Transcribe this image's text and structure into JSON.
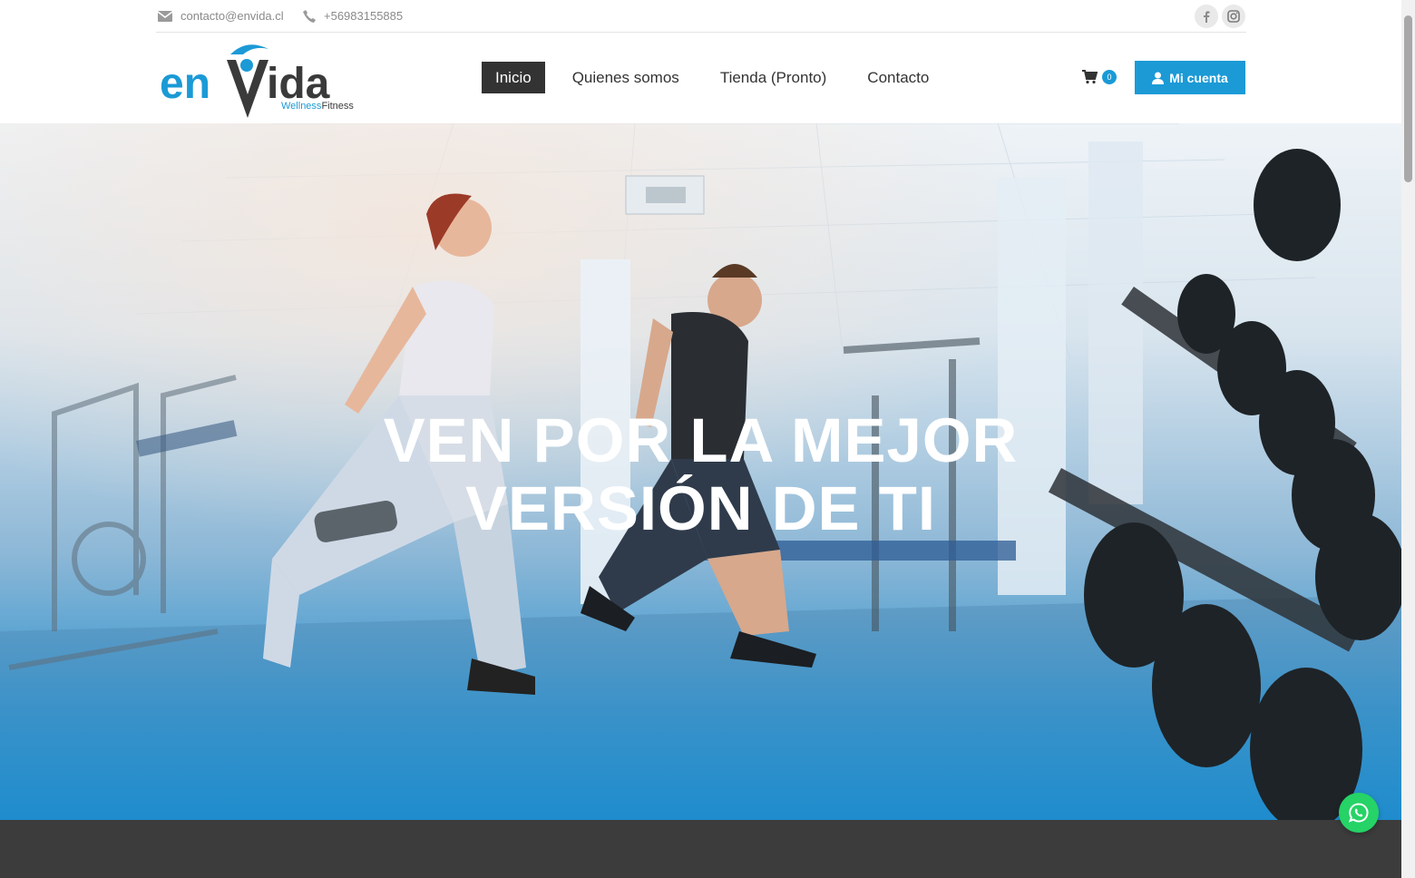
{
  "topbar": {
    "email": "contacto@envida.cl",
    "phone": "+56983155885",
    "icons": [
      "mail-icon",
      "phone-icon",
      "facebook-icon",
      "instagram-icon"
    ]
  },
  "header": {
    "logo": {
      "text_main_left": "en",
      "text_main_right": "ida",
      "subtitle": "WellnessFitness"
    },
    "nav": [
      {
        "label": "Inicio",
        "active": true
      },
      {
        "label": "Quienes somos",
        "active": false
      },
      {
        "label": "Tienda (Pronto)",
        "active": false
      },
      {
        "label": "Contacto",
        "active": false
      }
    ],
    "cart_count": "0",
    "account_label": "Mi cuenta"
  },
  "hero": {
    "title_line1": "VEN POR LA MEJOR",
    "title_line2": "VERSIÓN DE TI"
  },
  "colors": {
    "accent": "#1b9ad6",
    "dark": "#333333",
    "footer": "#3c3c3c",
    "whatsapp": "#25d366"
  }
}
